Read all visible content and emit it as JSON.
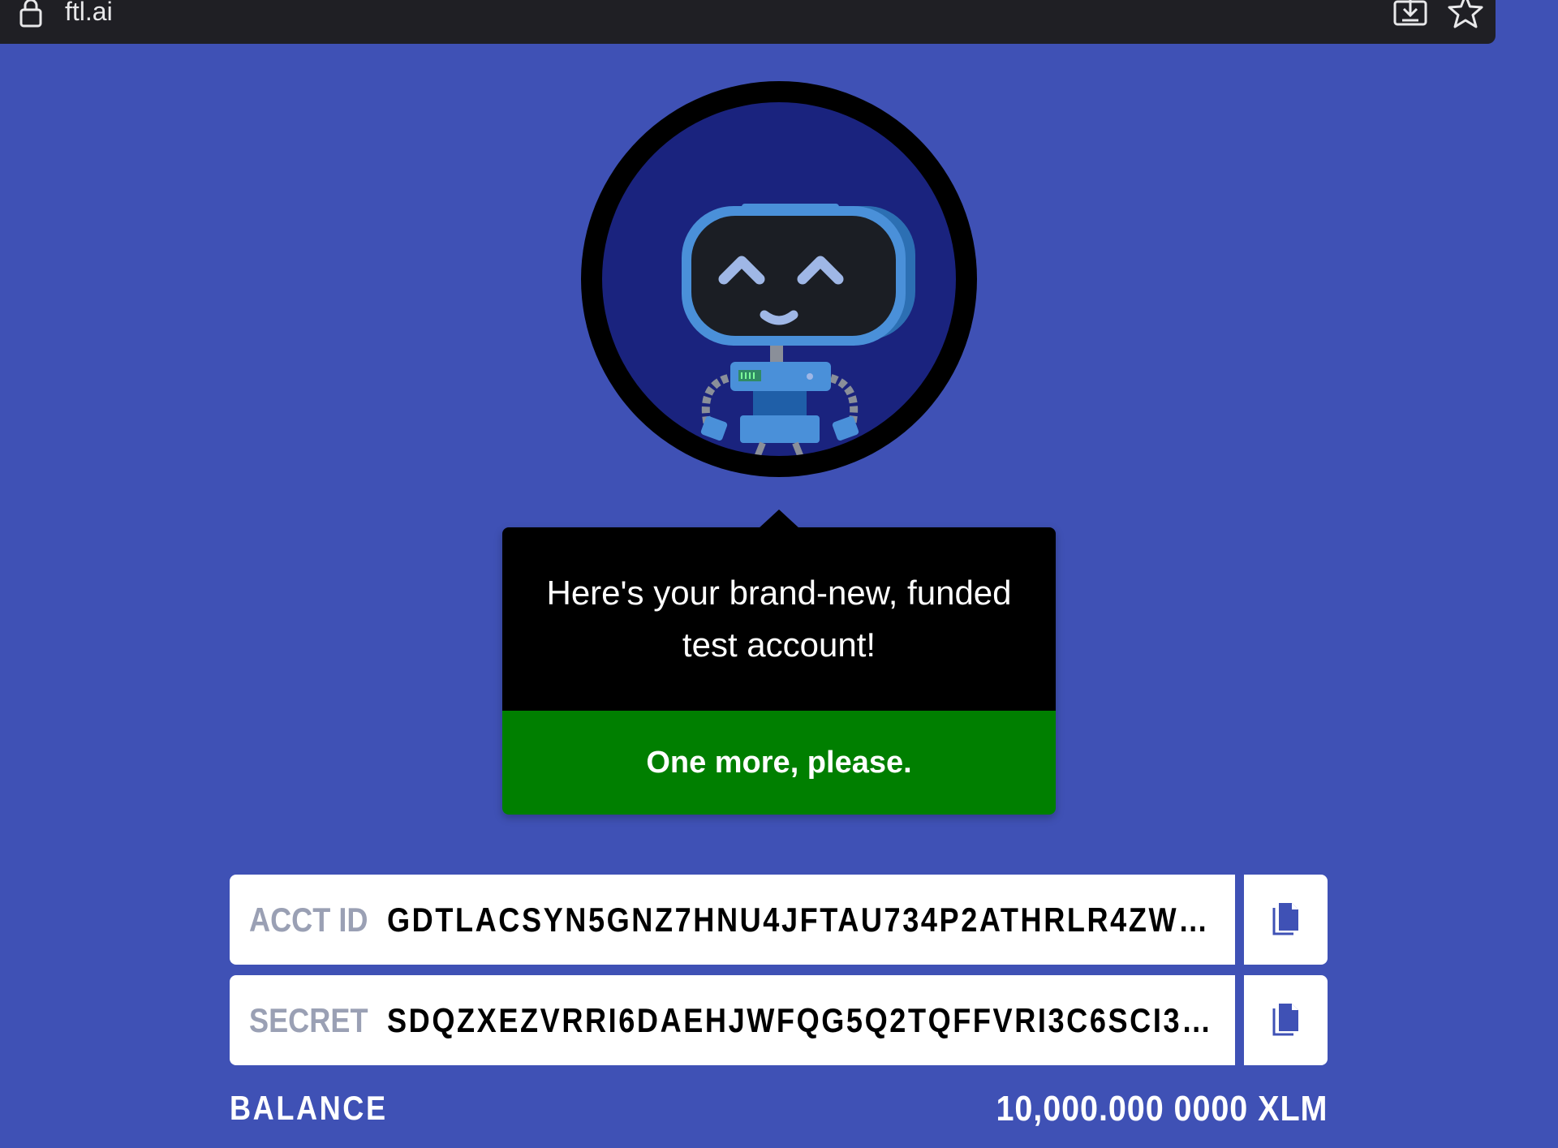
{
  "browser": {
    "url": "ftl.ai",
    "icons": [
      "lock-icon",
      "download-icon",
      "star-icon"
    ]
  },
  "robot": {
    "colors": {
      "ring": "#000000",
      "background": "#1a237e",
      "head": "#4a90d9",
      "face": "#1b1e24",
      "eyes": "#9fb7e6"
    }
  },
  "card": {
    "message": "Here's your brand-new, funded test account!",
    "button_label": "One more, please.",
    "button_color": "#007f00"
  },
  "account": {
    "acct_label": "ACCT ID",
    "acct_value": "GDTLACSYN5GNZ7HNU4JFTAU734P2ATHRLR4ZW…",
    "secret_label": "SECRET",
    "secret_value": "SDQZXEZVRRI6DAEHJWFQG5Q2TQFFVRI3C6SCI3…",
    "copy_icon": "document-copy-icon"
  },
  "balance": {
    "label": "BALANCE",
    "value": "10,000.000 0000 XLM"
  },
  "theme": {
    "page_bg": "#3f51b5"
  }
}
